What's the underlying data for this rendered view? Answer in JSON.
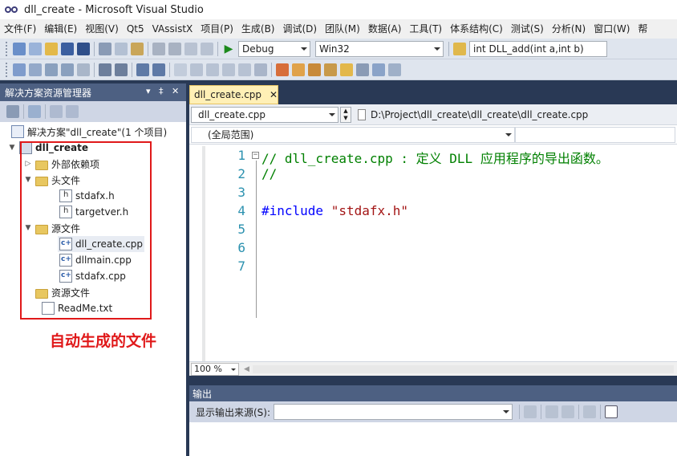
{
  "window": {
    "title": "dll_create - Microsoft Visual Studio"
  },
  "menu": [
    "文件(F)",
    "编辑(E)",
    "视图(V)",
    "Qt5",
    "VAssistX",
    "项目(P)",
    "生成(B)",
    "调试(D)",
    "团队(M)",
    "数据(A)",
    "工具(T)",
    "体系结构(C)",
    "测试(S)",
    "分析(N)",
    "窗口(W)",
    "帮"
  ],
  "toolbar": {
    "config": "Debug",
    "platform": "Win32",
    "function_search": "int DLL_add(int a,int b)"
  },
  "solution_explorer": {
    "title": "解决方案资源管理器",
    "pin": "▾ ‡ ✕",
    "solution": "解决方案\"dll_create\"(1 个项目)",
    "project": "dll_create",
    "items": [
      {
        "label": "外部依赖项",
        "icon": "external-deps-icon"
      },
      {
        "label": "头文件",
        "icon": "folder-icon"
      },
      {
        "label": "stdafx.h",
        "icon": "header-file-icon"
      },
      {
        "label": "targetver.h",
        "icon": "header-file-icon"
      },
      {
        "label": "源文件",
        "icon": "folder-icon"
      },
      {
        "label": "dll_create.cpp",
        "icon": "cpp-file-icon"
      },
      {
        "label": "dllmain.cpp",
        "icon": "cpp-file-icon"
      },
      {
        "label": "stdafx.cpp",
        "icon": "cpp-file-icon"
      },
      {
        "label": "资源文件",
        "icon": "folder-icon"
      },
      {
        "label": "ReadMe.txt",
        "icon": "text-file-icon"
      }
    ],
    "annotation": "自动生成的文件"
  },
  "editor": {
    "tab": "dll_create.cpp",
    "tab_close": "✕",
    "file_combo": "dll_create.cpp",
    "path": "D:\\Project\\dll_create\\dll_create\\dll_create.cpp",
    "scope": "(全局范围)",
    "zoom": "100 %",
    "lines": [
      {
        "n": "1",
        "text": "// dll_create.cpp : 定义 DLL 应用程序的导出函数。",
        "kind": "comment"
      },
      {
        "n": "2",
        "text": "//",
        "kind": "comment"
      },
      {
        "n": "3",
        "text": "",
        "kind": "plain"
      },
      {
        "n": "4",
        "kw": "#include",
        "str": "\"stdafx.h\"",
        "kind": "include"
      },
      {
        "n": "5",
        "text": "",
        "kind": "plain"
      },
      {
        "n": "6",
        "text": "",
        "kind": "plain"
      },
      {
        "n": "7",
        "text": "",
        "kind": "plain"
      }
    ],
    "colors": {
      "comment": "#008000",
      "keyword": "#0000ff",
      "string": "#a31515",
      "line_number": "#2b91af"
    }
  },
  "output": {
    "title": "输出",
    "source_label": "显示输出来源(S):",
    "source_value": ""
  }
}
